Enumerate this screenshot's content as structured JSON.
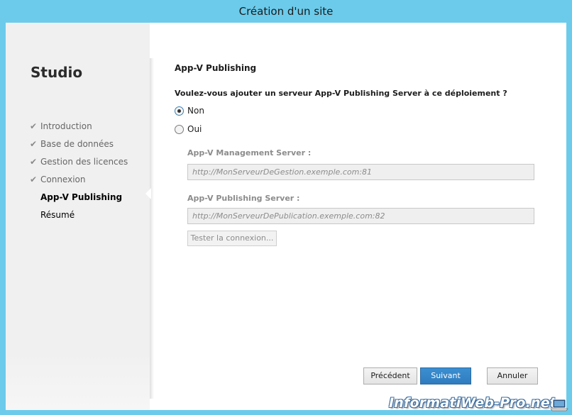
{
  "window": {
    "title": "Création d'un site"
  },
  "sidebar": {
    "heading": "Studio",
    "steps": [
      {
        "label": "Introduction",
        "state": "done"
      },
      {
        "label": "Base de données",
        "state": "done"
      },
      {
        "label": "Gestion des licences",
        "state": "done"
      },
      {
        "label": "Connexion",
        "state": "done"
      },
      {
        "label": "App-V Publishing",
        "state": "active"
      },
      {
        "label": "Résumé",
        "state": "pending"
      }
    ]
  },
  "main": {
    "section_title": "App-V Publishing",
    "question": "Voulez-vous ajouter un serveur App-V Publishing Server à ce déploiement ?",
    "options": [
      {
        "label": "Non",
        "selected": true
      },
      {
        "label": "Oui",
        "selected": false
      }
    ],
    "management_label": "App-V Management Server :",
    "management_placeholder": "http://MonServeurDeGestion.exemple.com:81",
    "publishing_label": "App-V Publishing Server :",
    "publishing_placeholder": "http://MonServeurDePublication.exemple.com:82",
    "test_button": "Tester la connexion..."
  },
  "footer": {
    "previous": "Précédent",
    "next": "Suivant",
    "cancel": "Annuler"
  },
  "watermark": "InformatiWeb-Pro.net",
  "colors": {
    "titlebar": "#6ccbeb",
    "primary_button": "#3b8fd1",
    "sidebar": "#f0f0f0"
  }
}
